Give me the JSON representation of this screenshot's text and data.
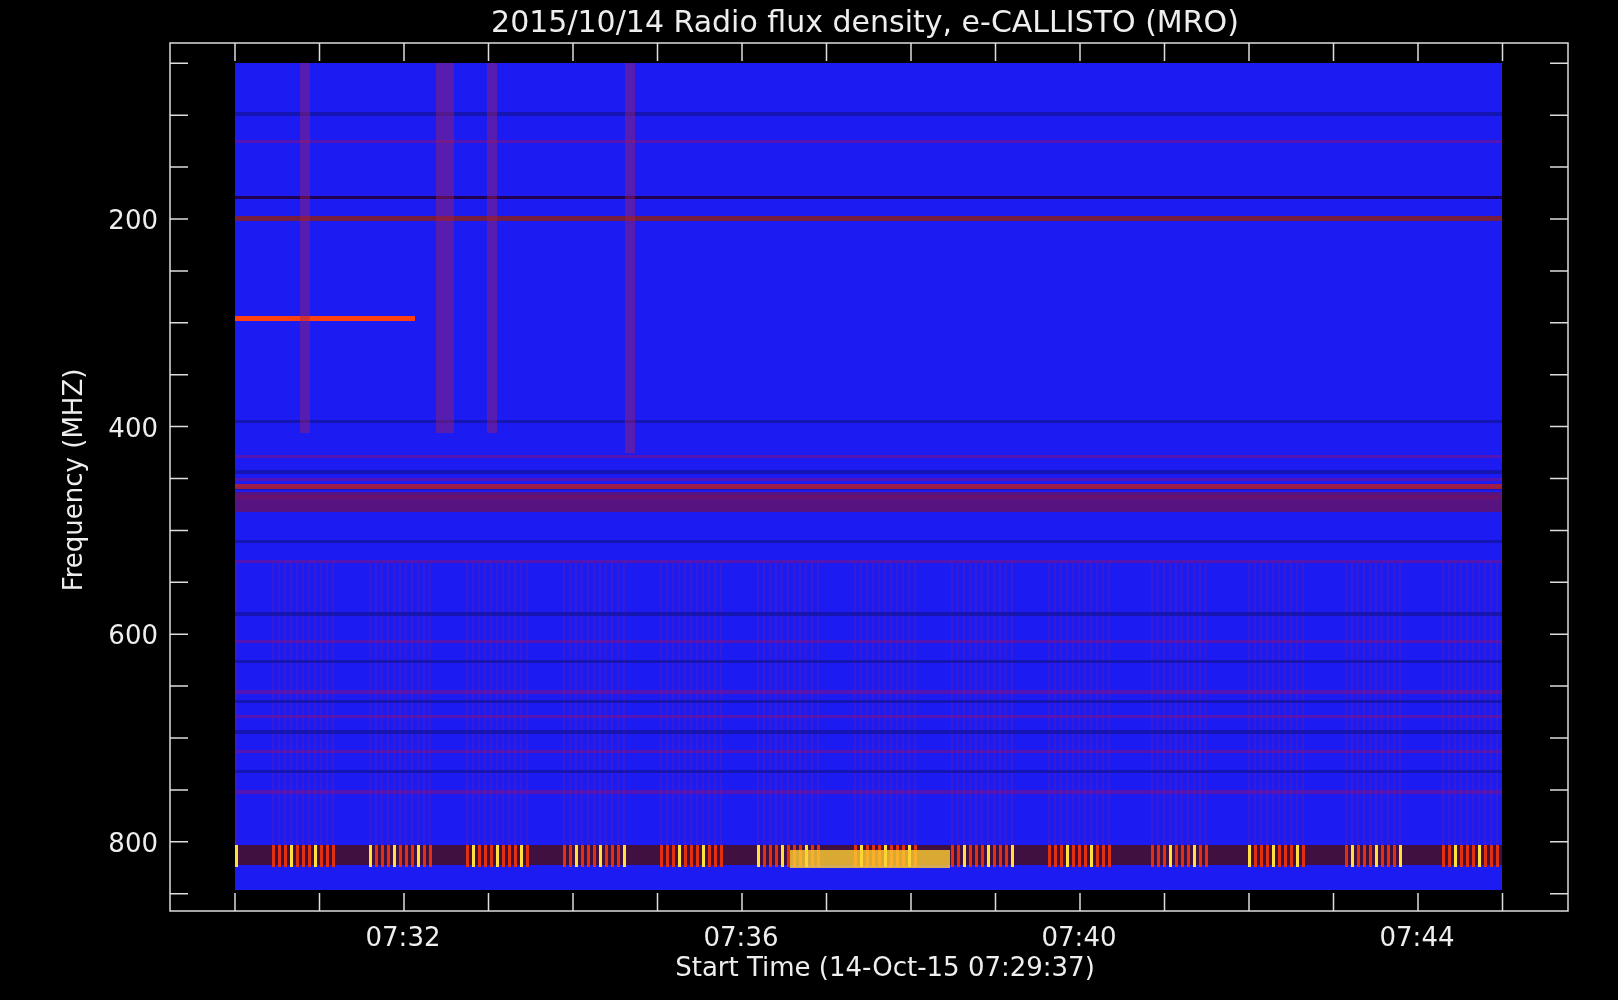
{
  "title": "2015/10/14  Radio flux density, e-CALLISTO (MRO)",
  "y_axis": {
    "label": "Frequency (MHZ)",
    "ticks": [
      "200",
      "400",
      "600",
      "800"
    ]
  },
  "x_axis": {
    "label": "Start Time (14-Oct-15 07:29:37)",
    "ticks": [
      "07:32",
      "07:36",
      "07:40",
      "07:44"
    ]
  }
}
